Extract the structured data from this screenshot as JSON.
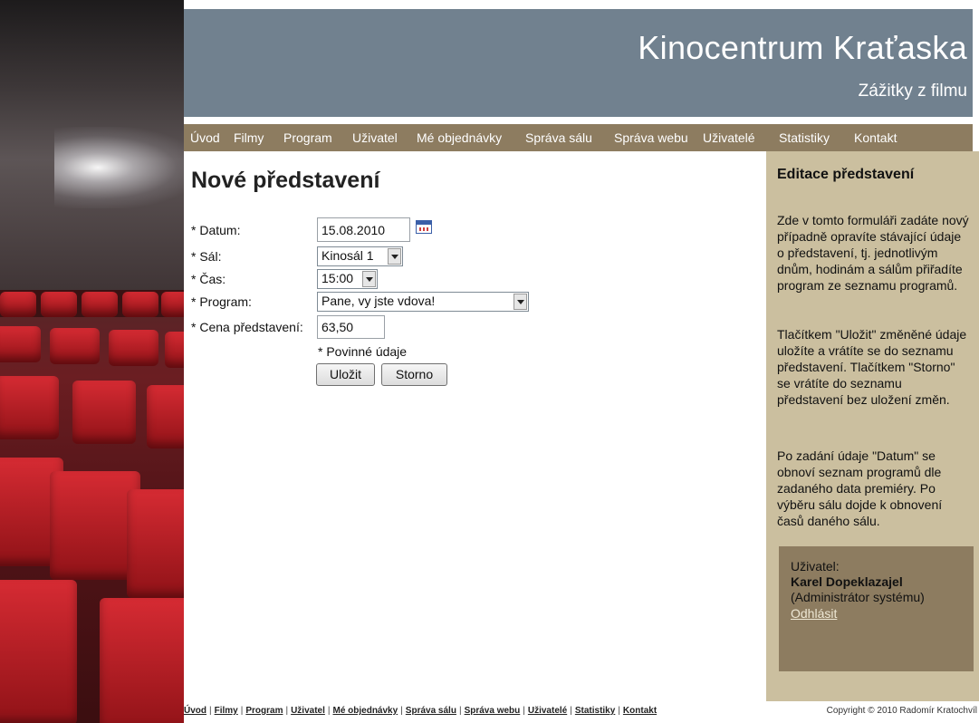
{
  "header": {
    "title": "Kinocentrum Kraťaska",
    "subtitle": "Zážitky z filmu"
  },
  "nav": {
    "items": [
      "Úvod",
      "Filmy",
      "Program",
      "Uživatel",
      "Mé objednávky",
      "Správa sálu",
      "Správa webu",
      "Uživatelé",
      "Statistiky",
      "Kontakt"
    ]
  },
  "main": {
    "title": "Nové představení",
    "form": {
      "date_label": "* Datum:",
      "date_value": "15.08.2010",
      "hall_label": "* Sál:",
      "hall_value": "Kinosál 1",
      "time_label": "* Čas:",
      "time_value": "15:00",
      "program_label": "* Program:",
      "program_value": "Pane, vy jste vdova!",
      "price_label": "* Cena představení:",
      "price_value": "63,50",
      "required_note": "* Povinné údaje",
      "save_label": "Uložit",
      "cancel_label": "Storno"
    }
  },
  "sidebar": {
    "title": "Editace představení",
    "paragraphs": [
      "Zde v tomto formuláři zadáte nový případně opravíte stávající údaje o představení, tj. jednotlivým dnům, hodinám a sálům přiřadíte program ze seznamu programů.",
      "Tlačítkem \"Uložit\" změněné údaje uložíte a vrátíte se do seznamu představení. Tlačítkem \"Storno\" se vrátíte do seznamu představení bez uložení změn.",
      "Po zadání údaje \"Datum\" se obnoví seznam programů dle zadaného data premiéry. Po výběru sálu dojde k obnovení časů daného sálu."
    ],
    "user": {
      "label": "Uživatel:",
      "name": "Karel Dopeklazajel",
      "role": "(Administrátor systému)",
      "logout": "Odhlásit"
    }
  },
  "footer": {
    "links": [
      "Úvod",
      "Filmy",
      "Program",
      "Uživatel",
      "Mé objednávky",
      "Správa sálu",
      "Správa webu",
      "Uživatelé",
      "Statistiky",
      "Kontakt"
    ],
    "separator": "|",
    "copyright": "Copyright © 2010 Radomír Kratochvíl"
  },
  "colors": {
    "header_bg": "#71818f",
    "nav_bg": "#8d7c60",
    "sidebar_bg": "#cbbf9f",
    "userbox_bg": "#8d7c60"
  },
  "icons": {
    "calendar": "calendar-icon",
    "dropdown": "chevron-down-icon"
  }
}
